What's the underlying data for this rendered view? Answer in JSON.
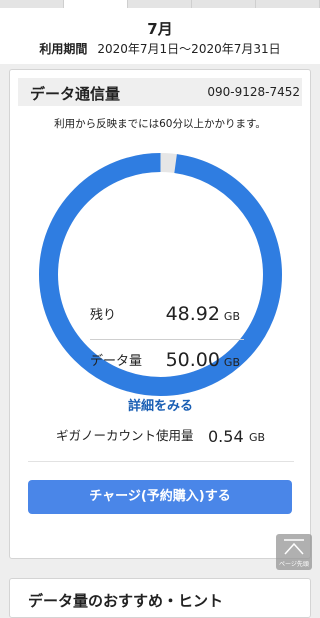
{
  "period": {
    "month": "7月",
    "label": "利用期間",
    "range": "2020年7月1日〜2020年7月31日"
  },
  "usage_card": {
    "title": "データ通信量",
    "phone": "090-9128-7452",
    "notice": "利用から反映までには60分以上かかります。",
    "remaining": {
      "label": "残り",
      "value": "48.92",
      "unit": "GB"
    },
    "data_amount": {
      "label": "データ量",
      "value": "50.00",
      "unit": "GB"
    },
    "remaining_fraction": 0.9784,
    "detail_link": "詳細をみる",
    "giga_nocount": {
      "label": "ギガノーカウント使用量",
      "value": "0.54",
      "unit": "GB"
    },
    "charge_button": "チャージ(予約購入)する"
  },
  "page_top": {
    "label": "ページ先頭",
    "icon": "arrow-up-icon"
  },
  "next_card": {
    "title": "データ量のおすすめ・ヒント"
  },
  "colors": {
    "ring": "#2f7de1",
    "ring_track": "#e6e6e6",
    "button": "#4a86e8",
    "link": "#1a5fb4"
  }
}
